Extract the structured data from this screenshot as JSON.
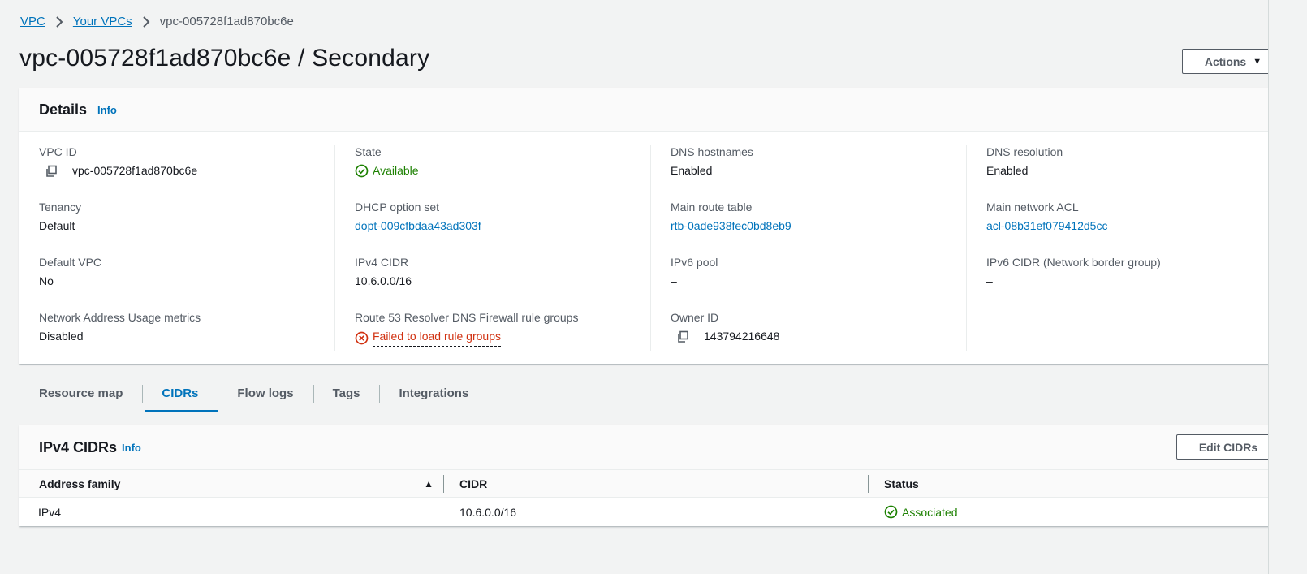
{
  "breadcrumb": {
    "items": [
      "VPC",
      "Your VPCs"
    ],
    "current": "vpc-005728f1ad870bc6e"
  },
  "page": {
    "title": "vpc-005728f1ad870bc6e / Secondary",
    "actions_label": "Actions"
  },
  "details": {
    "title": "Details",
    "info_label": "Info",
    "columns": [
      [
        {
          "label": "VPC ID",
          "value": "vpc-005728f1ad870bc6e"
        },
        {
          "label": "Tenancy",
          "value": "Default"
        },
        {
          "label": "Default VPC",
          "value": "No"
        },
        {
          "label": "Network Address Usage metrics",
          "value": "Disabled"
        }
      ],
      [
        {
          "label": "State",
          "value": "Available"
        },
        {
          "label": "DHCP option set",
          "value": "dopt-009cfbdaa43ad303f"
        },
        {
          "label": "IPv4 CIDR",
          "value": "10.6.0.0/16"
        },
        {
          "label": "Route 53 Resolver DNS Firewall rule groups",
          "value": "Failed to load rule groups"
        }
      ],
      [
        {
          "label": "DNS hostnames",
          "value": "Enabled"
        },
        {
          "label": "Main route table",
          "value": "rtb-0ade938fec0bd8eb9"
        },
        {
          "label": "IPv6 pool",
          "value": "–"
        },
        {
          "label": "Owner ID",
          "value": "143794216648"
        }
      ],
      [
        {
          "label": "DNS resolution",
          "value": "Enabled"
        },
        {
          "label": "Main network ACL",
          "value": "acl-08b31ef079412d5cc"
        },
        {
          "label": "IPv6 CIDR (Network border group)",
          "value": "–"
        }
      ]
    ]
  },
  "tabs": [
    "Resource map",
    "CIDRs",
    "Flow logs",
    "Tags",
    "Integrations"
  ],
  "active_tab": "CIDRs",
  "cidrs": {
    "title": "IPv4 CIDRs",
    "info_label": "Info",
    "edit_label": "Edit CIDRs",
    "columns": [
      "Address family",
      "CIDR",
      "Status"
    ],
    "rows": [
      {
        "family": "IPv4",
        "cidr": "10.6.0.0/16",
        "status": "Associated"
      }
    ]
  },
  "colors": {
    "link": "#0073bb",
    "success": "#1d8102",
    "error": "#d13212",
    "text": "#16191f",
    "muted": "#545b64"
  },
  "icons": {
    "copy": "copy-icon",
    "success": "check-circle-icon",
    "error": "x-circle-icon",
    "sort": "sort-ascending-icon",
    "chevron": "chevron-right-icon",
    "caret": "caret-down-icon"
  }
}
